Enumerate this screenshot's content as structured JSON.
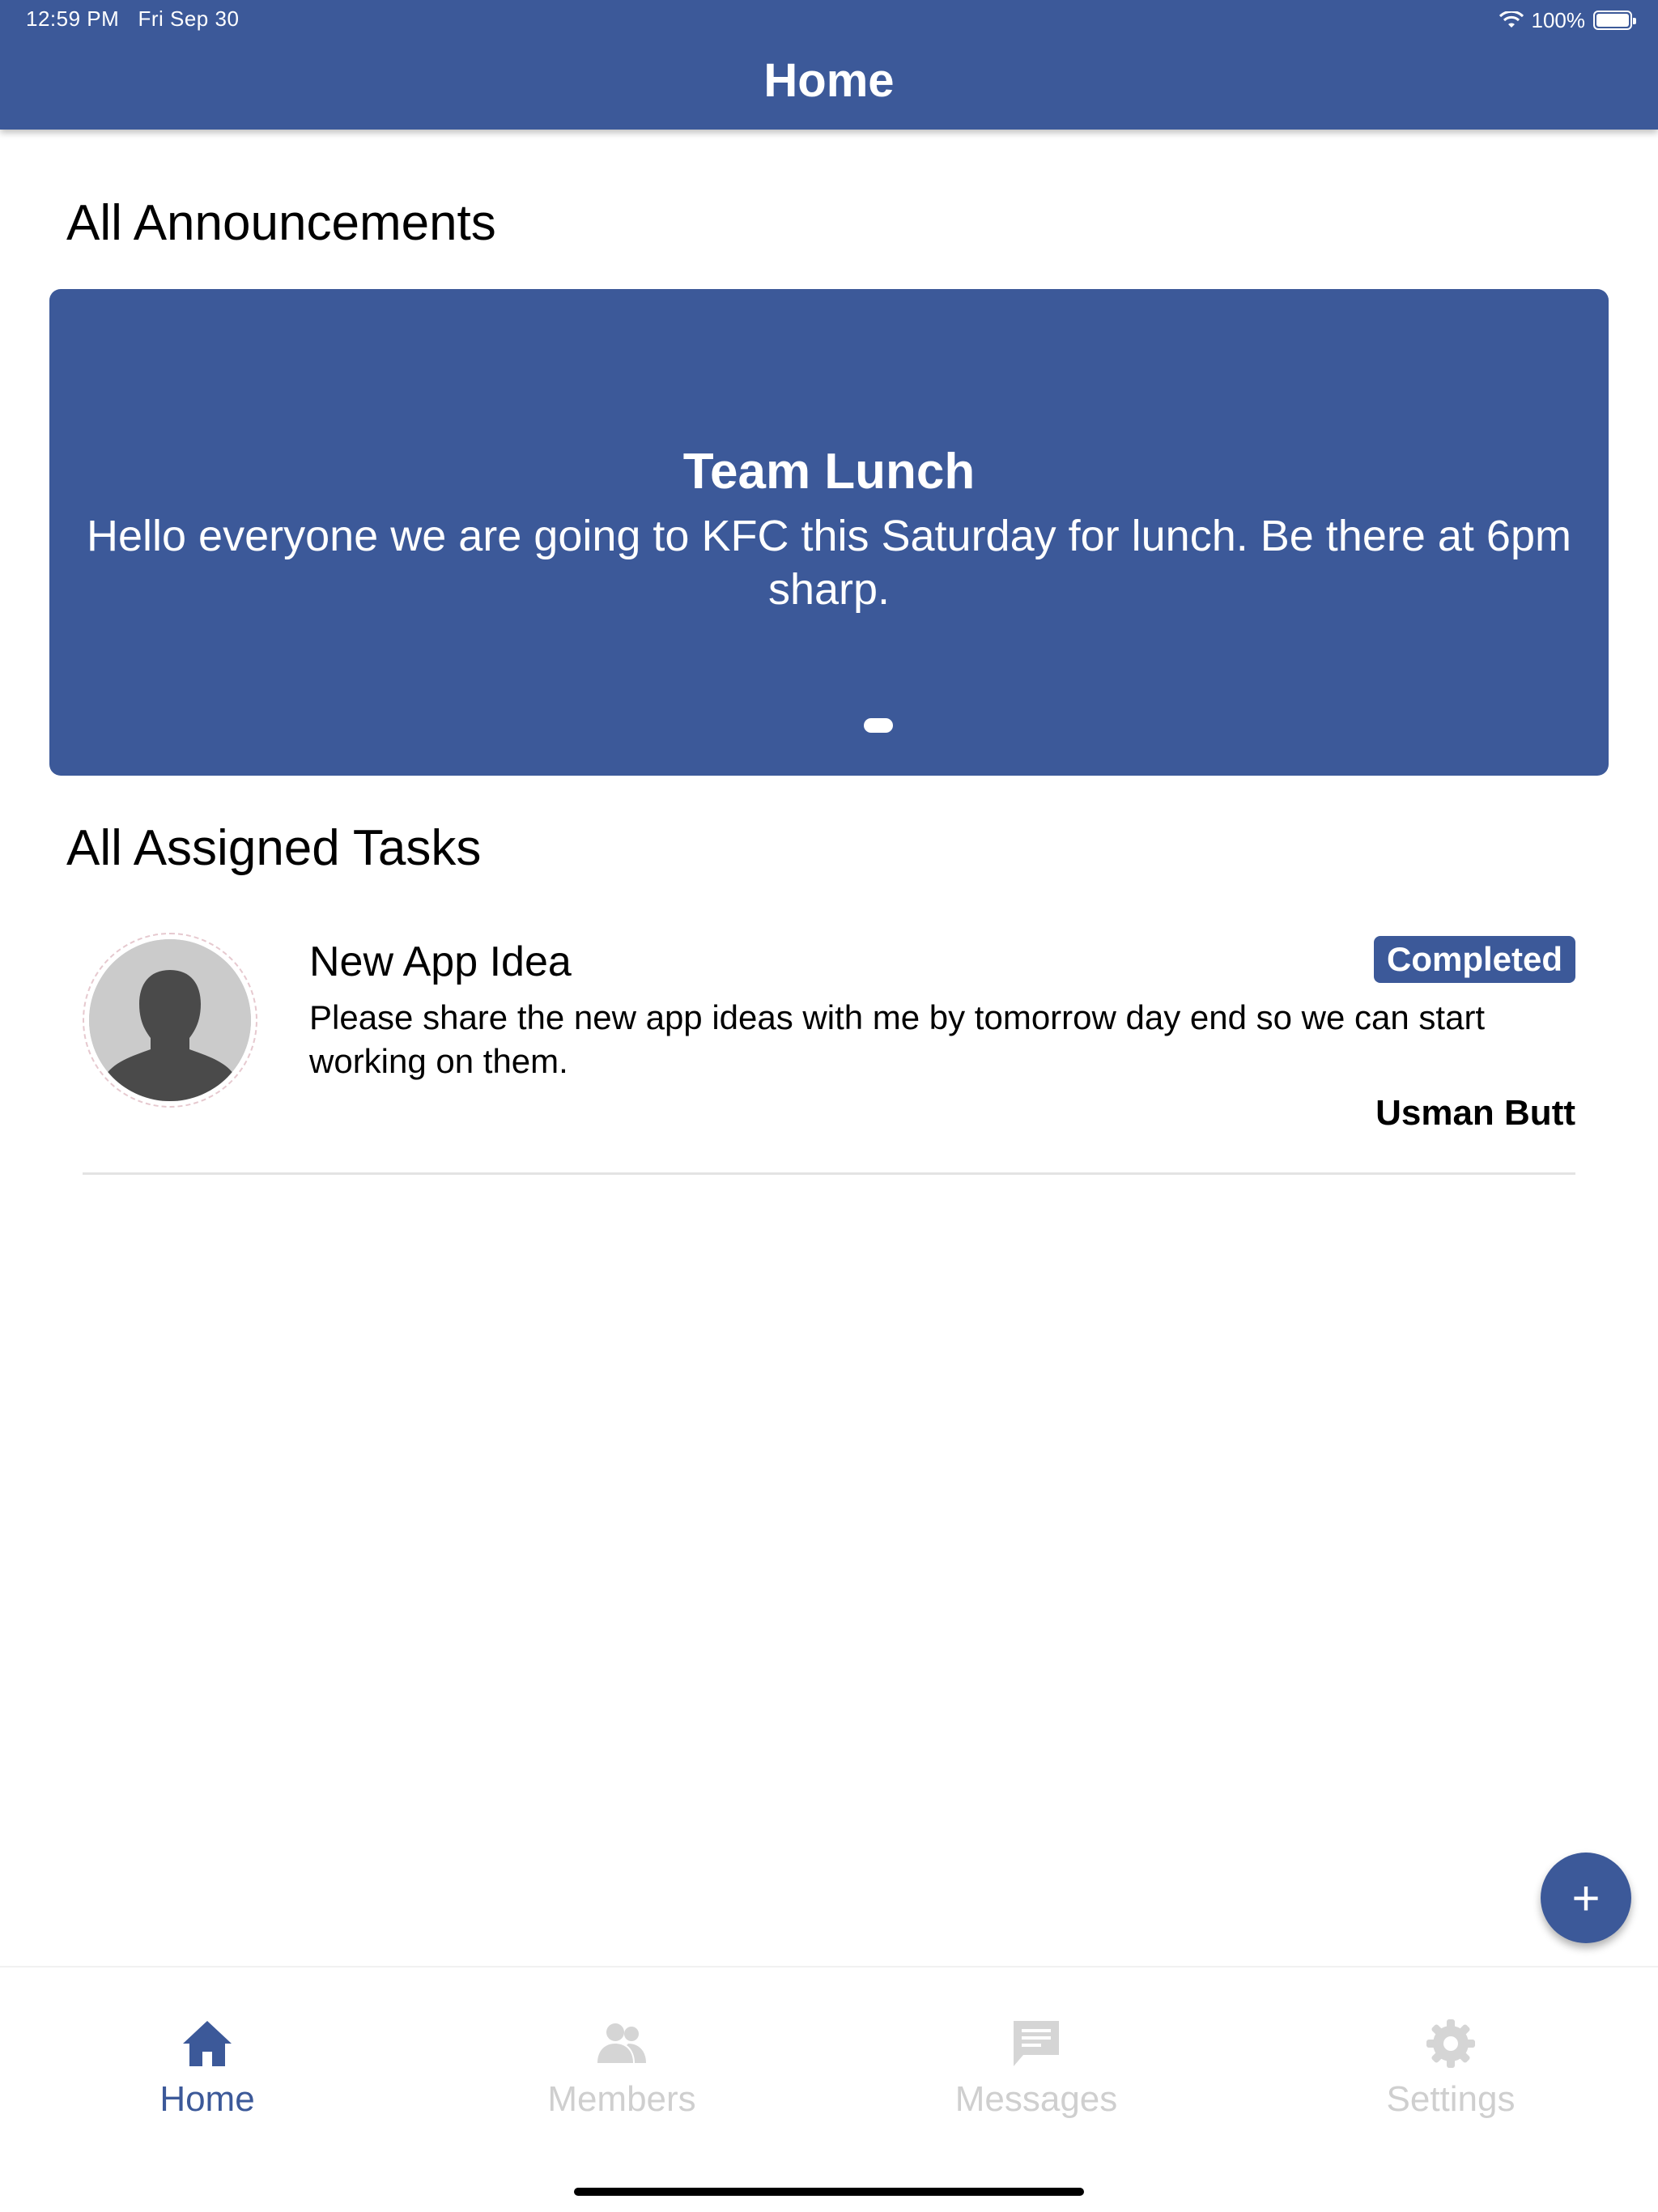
{
  "status_bar": {
    "time": "12:59 PM",
    "date": "Fri Sep 30",
    "battery": "100%"
  },
  "header": {
    "title": "Home"
  },
  "announcements": {
    "section_title": "All Announcements",
    "items": [
      {
        "title": "Team Lunch",
        "body": "Hello everyone we are going to KFC this Saturday for lunch. Be there at 6pm sharp."
      }
    ]
  },
  "tasks": {
    "section_title": "All Assigned Tasks",
    "items": [
      {
        "title": "New App Idea",
        "status": "Completed",
        "description": "Please share the new app ideas with me by tomorrow day end so we can start working on them.",
        "assigned_by": "Usman Butt"
      }
    ]
  },
  "fab": {
    "label": "+"
  },
  "tabbar": {
    "items": [
      {
        "label": "Home",
        "icon": "home-icon",
        "active": true
      },
      {
        "label": "Members",
        "icon": "people-icon",
        "active": false
      },
      {
        "label": "Messages",
        "icon": "message-icon",
        "active": false
      },
      {
        "label": "Settings",
        "icon": "gear-icon",
        "active": false
      }
    ]
  },
  "colors": {
    "primary": "#3c5999",
    "inactive": "#cfcfcf"
  }
}
